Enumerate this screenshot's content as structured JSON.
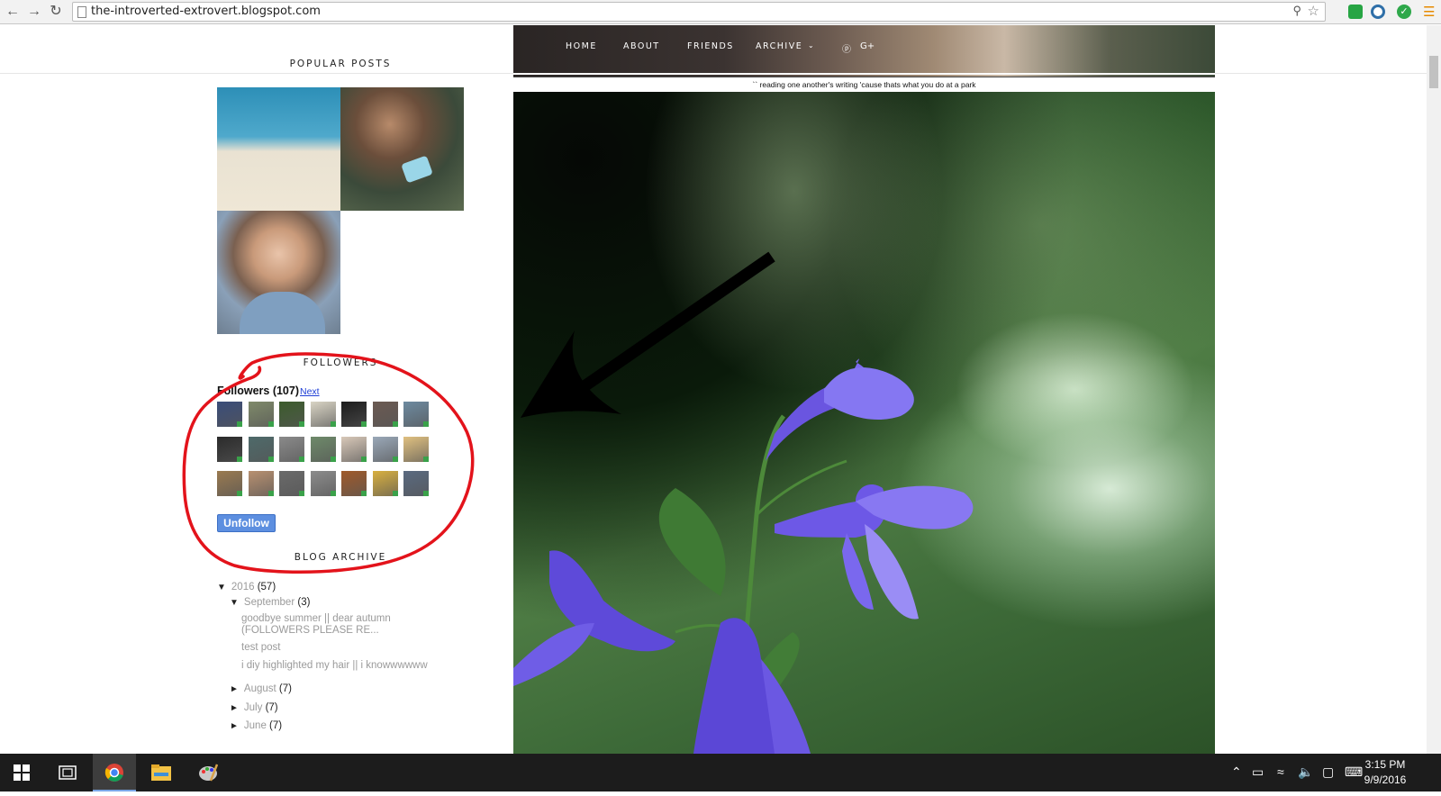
{
  "browser": {
    "url": "the-introverted-extrovert.blogspot.com",
    "back_icon": "back-arrow-icon",
    "forward_icon": "forward-arrow-icon",
    "reload_icon": "reload-icon"
  },
  "header": {
    "nav": [
      "HOME",
      "ABOUT",
      "FRIENDS",
      "ARCHIVE",
      "",
      ""
    ],
    "archive_chevron": "⌄",
    "pinterest": "ⓟ",
    "googleplus": "G+",
    "caption": "`` reading one another's writing 'cause thats what you do at a park"
  },
  "sidebar": {
    "popular_posts_title": "POPULAR POSTS",
    "followers_title": "FOLLOWERS",
    "followers_heading": "Followers (107)",
    "followers_next": "Next",
    "unfollow_label": "Unfollow",
    "blog_archive_title": "BLOG ARCHIVE",
    "archive": {
      "year": {
        "tri": "▼",
        "label": "2016",
        "count": "(57)"
      },
      "month_open": {
        "tri": "▼",
        "label": "September",
        "count": "(3)"
      },
      "posts": [
        "goodbye summer || dear autumn (FOLLOWERS PLEASE RE...",
        "test post",
        "i diy highlighted my hair || i knowwwwww"
      ],
      "months": [
        {
          "tri": "►",
          "label": "August",
          "count": "(7)"
        },
        {
          "tri": "►",
          "label": "July",
          "count": "(7)"
        },
        {
          "tri": "►",
          "label": "June",
          "count": "(7)"
        }
      ]
    }
  },
  "colors": {
    "annotation_red": "#e3131b",
    "follow_button": "#5d8fe0",
    "link_blue": "#1f3fd6"
  },
  "taskbar": {
    "time": "3:15 PM",
    "date": "9/9/2016"
  }
}
